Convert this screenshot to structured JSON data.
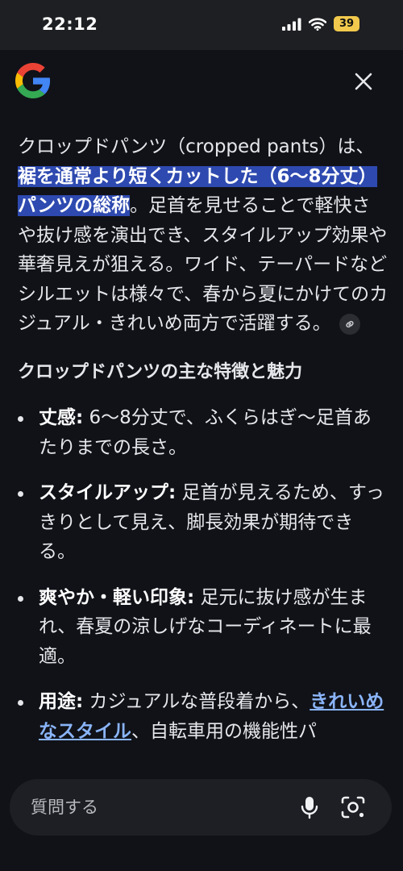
{
  "status": {
    "time": "22:12",
    "battery": "39"
  },
  "article": {
    "intro_before": "クロップドパンツ（cropped pants）は、",
    "intro_highlight": "裾を通常より短くカットした（6〜8分丈）パンツの総称",
    "intro_after": "。足首を見せることで軽快さや抜け感を演出でき、スタイルアップ効果や華奢見えが狙える。ワイド、テーパードなどシルエットは様々で、春から夏にかけてのカジュアル・きれいめ両方で活躍する。",
    "section_title": "クロップドパンツの主な特徴と魅力",
    "features": [
      {
        "term": "丈感:",
        "text": " 6〜8分丈で、ふくらはぎ〜足首あたりまでの長さ。"
      },
      {
        "term": "スタイルアップ:",
        "text": " 足首が見えるため、すっきりとして見え、脚長効果が期待できる。"
      },
      {
        "term": "爽やか・軽い印象:",
        "text": " 足元に抜け感が生まれ、春夏の涼しげなコーディネートに最適。"
      },
      {
        "term": "用途:",
        "text": " カジュアルな普段着から、",
        "link": "きれいめなスタイル",
        "text_after": "、自転車用の機能性パ"
      }
    ]
  },
  "ask_bar": {
    "placeholder": "質問する"
  },
  "icons": {
    "logo": "google-g-logo",
    "close": "close-icon",
    "link": "link-icon",
    "mic": "microphone-icon",
    "lens": "lens-camera-icon",
    "signal": "signal-icon",
    "wifi": "wifi-icon"
  },
  "colors": {
    "highlight": "#2e4ab0",
    "link": "#8ab4f8",
    "battery": "#f2c94c"
  }
}
